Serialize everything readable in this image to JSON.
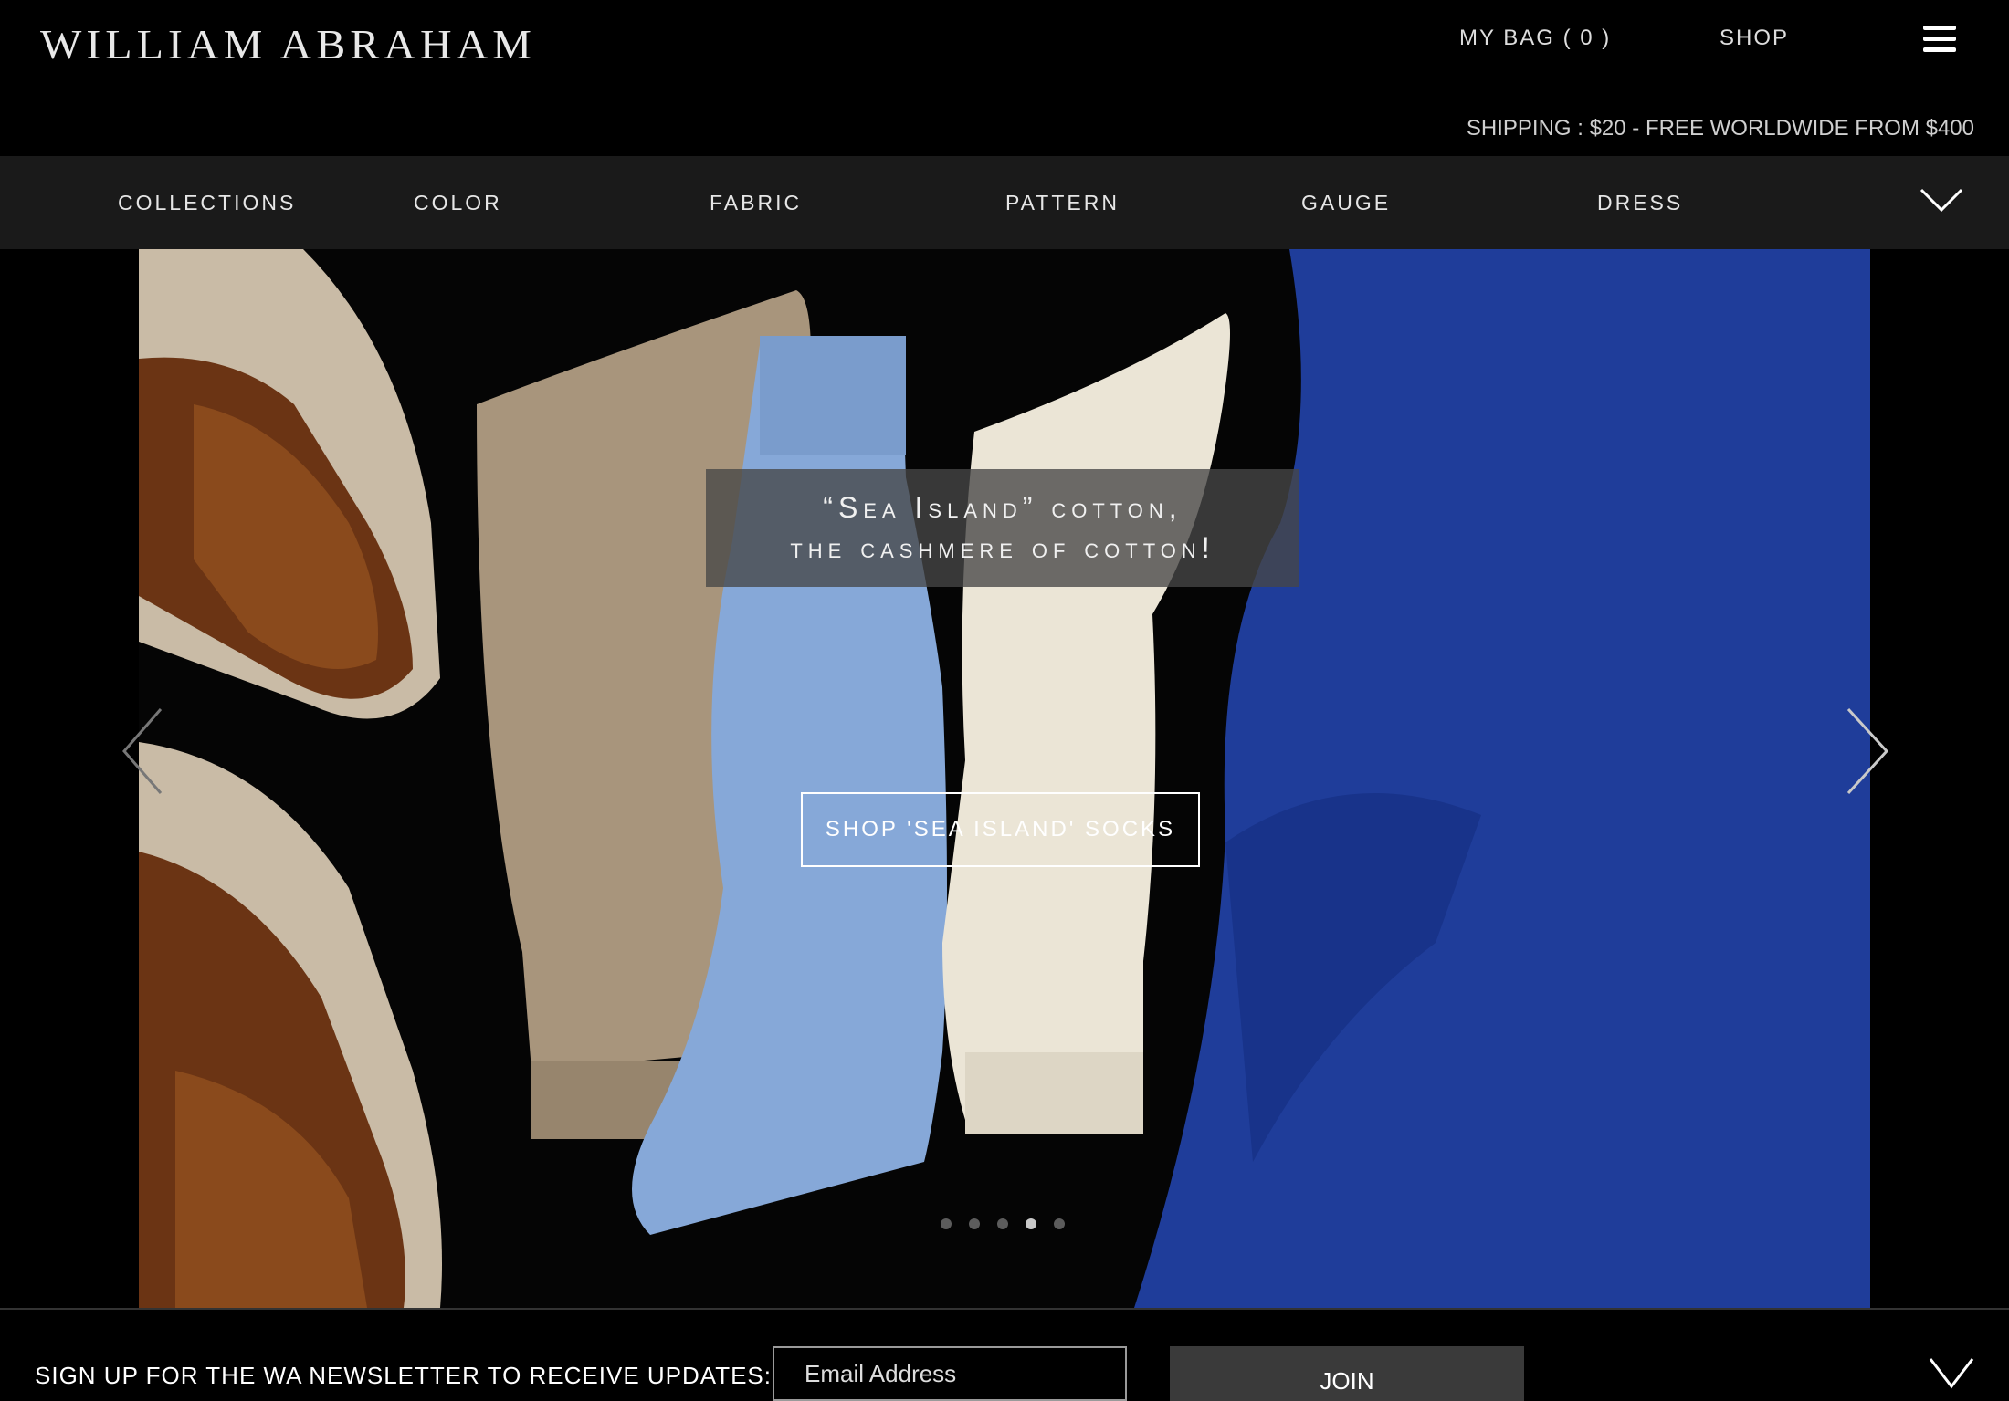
{
  "header": {
    "logo": "WILLIAM ABRAHAM",
    "bag_label": "MY BAG ( 0 )",
    "shop_label": "SHOP",
    "shipping": "SHIPPING : $20 - FREE WORLDWIDE FROM $400"
  },
  "nav": {
    "items": [
      "COLLECTIONS",
      "COLOR",
      "FABRIC",
      "PATTERN",
      "GAUGE",
      "DRESS"
    ]
  },
  "hero": {
    "tagline_line1": "“Sea Island” cotton,",
    "tagline_line2": "the cashmere of cotton!",
    "button_label": "SHOP 'SEA ISLAND' SOCKS",
    "active_slide_index": 3,
    "slide_count": 5,
    "colors": {
      "sock_tan": "#a8957c",
      "sock_blue": "#86a8d8",
      "sock_cream": "#ebe5d6",
      "trouser_blue": "#1f3d9a",
      "shoe_brown": "#8a4a1c",
      "shoe_linen": "#c9bba6"
    }
  },
  "newsletter": {
    "label": "SIGN UP FOR THE WA NEWSLETTER TO RECEIVE UPDATES:",
    "placeholder": "Email Address",
    "join_label": "JOIN"
  },
  "icons": {
    "menu": "hamburger-icon",
    "nav_toggle": "chevron-down-icon",
    "prev": "chevron-left-icon",
    "next": "chevron-right-icon"
  }
}
